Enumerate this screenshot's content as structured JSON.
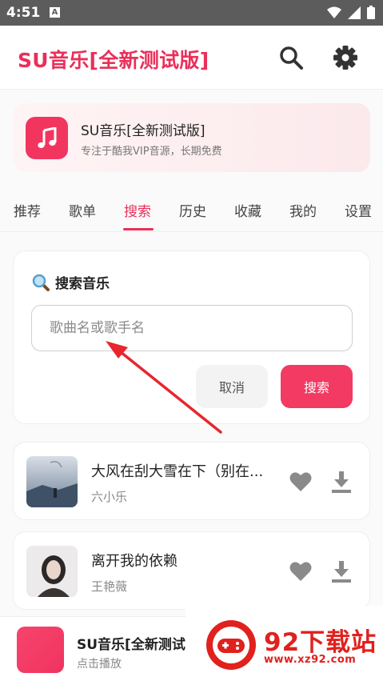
{
  "status_bar": {
    "time": "4:51",
    "notification_badge": "A"
  },
  "app_bar": {
    "title": "SU音乐[全新测试版]"
  },
  "banner": {
    "title": "SU音乐[全新测试版]",
    "subtitle": "专注于酷我VIP音源，长期免费"
  },
  "tabs": [
    "推荐",
    "歌单",
    "搜索",
    "历史",
    "收藏",
    "我的",
    "设置"
  ],
  "active_tab": "搜索",
  "search": {
    "heading": "搜索音乐",
    "placeholder": "歌曲名或歌手名",
    "value": "",
    "cancel_label": "取消",
    "search_label": "搜索"
  },
  "songs": [
    {
      "title": "大风在刮大雪在下（别在...",
      "artist": "六小乐"
    },
    {
      "title": "离开我的依赖",
      "artist": "王艳薇"
    }
  ],
  "player": {
    "title": "SU音乐[全新测试版]",
    "subtitle": "点击播放"
  },
  "watermark": {
    "text": "92下载站",
    "url": "www.xz92.com"
  },
  "colors": {
    "accent": "#e8305a",
    "button": "#f23a62",
    "watermark": "#e0211e"
  },
  "icons": [
    "search-icon",
    "gear-icon",
    "music-note-icon",
    "magnifier-emoji-icon",
    "heart-icon",
    "download-icon"
  ]
}
